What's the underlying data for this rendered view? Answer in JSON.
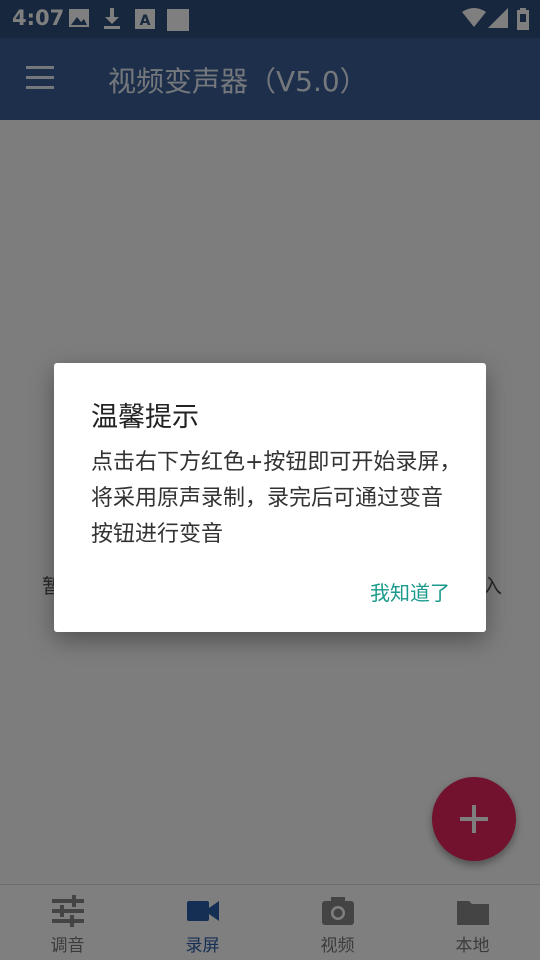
{
  "status_bar": {
    "time": "4:07",
    "left_icons": [
      "image-icon",
      "download-icon",
      "text-icon",
      "square-icon"
    ],
    "right_icons": [
      "wifi-icon",
      "signal-icon",
      "battery-icon"
    ]
  },
  "app_bar": {
    "title": "视频变声器（V5.0）",
    "menu_icon": "menu-icon"
  },
  "content": {
    "empty_text_left": "暂",
    "empty_text_right": "入"
  },
  "bottom_nav": {
    "items": [
      {
        "label": "调音",
        "icon": "tune-icon",
        "active": false
      },
      {
        "label": "录屏",
        "icon": "videocam-icon",
        "active": true
      },
      {
        "label": "视频",
        "icon": "camera-icon",
        "active": false
      },
      {
        "label": "本地",
        "icon": "folder-icon",
        "active": false
      }
    ]
  },
  "fab": {
    "icon": "add-icon"
  },
  "dialog": {
    "title": "温馨提示",
    "message": "点击右下方红色+按钮即可开始录屏，将采用原声录制，录完后可通过变音按钮进行变音",
    "button_label": "我知道了"
  },
  "colors": {
    "app_bar": "#3a5f95",
    "status_bar": "#2f4f7c",
    "fab": "#e5245e",
    "dialog_button": "#1a9a8c",
    "nav_active": "#2b5fa8"
  }
}
